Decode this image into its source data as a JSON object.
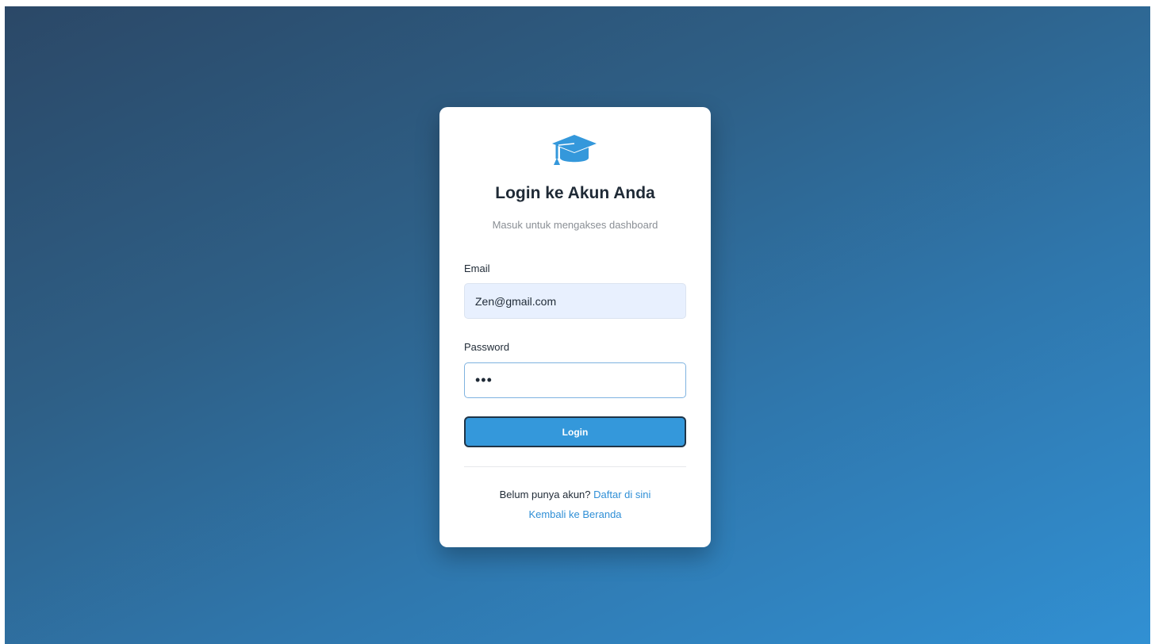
{
  "page": {
    "icon": "graduation-cap-icon",
    "title": "Login ke Akun Anda",
    "subtitle": "Masuk untuk mengakses dashboard"
  },
  "form": {
    "email": {
      "label": "Email",
      "value": "Zen@gmail.com"
    },
    "password": {
      "label": "Password",
      "value": "•••"
    },
    "submit_label": "Login"
  },
  "footer": {
    "register_prompt": "Belum punya akun?",
    "register_link": "Daftar di sini",
    "home_link": "Kembali ke Beranda"
  },
  "colors": {
    "accent": "#3498db",
    "link": "#2f8fd6",
    "background_start": "#2b4867",
    "background_end": "#3190d3"
  }
}
